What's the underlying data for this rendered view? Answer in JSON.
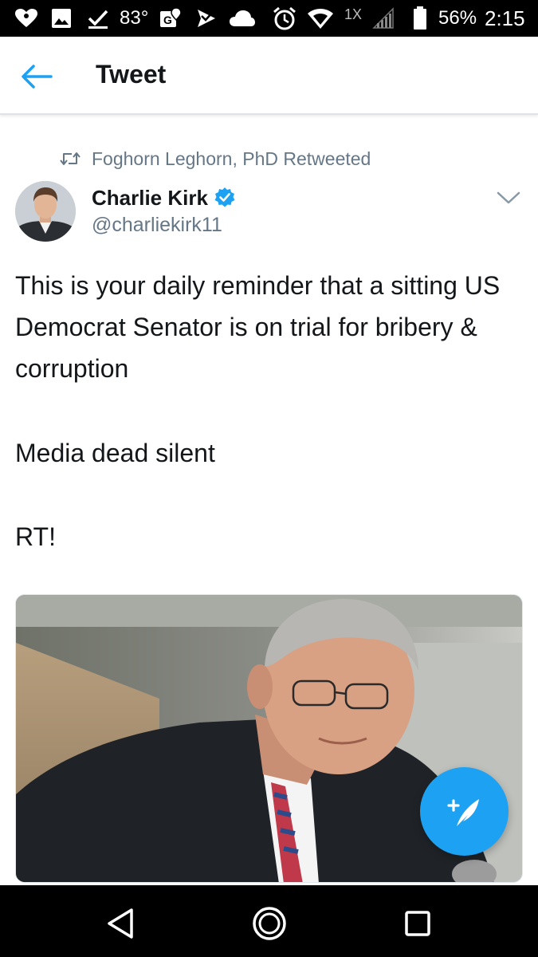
{
  "status_bar": {
    "temperature": "83°",
    "battery_percent": "56%",
    "time": "2:15",
    "icons": [
      "iheartradio-icon",
      "image-icon",
      "checkmark-icon",
      "maps-icon",
      "send-icon",
      "cloud-icon",
      "alarm-icon",
      "wifi-icon",
      "signal-icon",
      "battery-icon"
    ]
  },
  "app_bar": {
    "title": "Tweet"
  },
  "tweet": {
    "retweeted_by": "Foghorn Leghorn, PhD Retweeted",
    "author_name": "Charlie Kirk",
    "author_handle": "@charliekirk11",
    "verified": true,
    "paragraphs": [
      "This is your daily reminder that a sitting US Democrat Senator is on trial for bribery & corruption",
      "Media dead silent",
      "RT!"
    ]
  },
  "colors": {
    "accent": "#1da1f2",
    "secondary_text": "#657786",
    "primary_text": "#14171a"
  }
}
